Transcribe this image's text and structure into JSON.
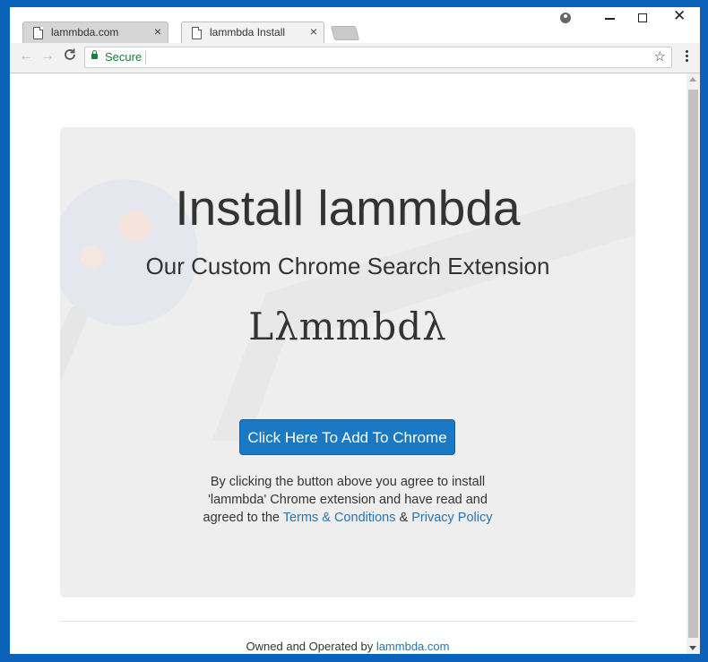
{
  "browser": {
    "tabs": [
      {
        "title": "lammbda.com",
        "active": false,
        "icon": "document-icon"
      },
      {
        "title": "lammbda Install",
        "active": true,
        "icon": "document-icon"
      }
    ],
    "tab_close_glyph": "×",
    "nav": {
      "back": "←",
      "forward": "→",
      "reload": "C"
    },
    "address": {
      "security_label": "Secure",
      "url": "",
      "security_color": "#188038"
    },
    "bookmark_glyph": "☆",
    "window_controls": {
      "close": "✕"
    }
  },
  "page": {
    "heading": "Install lammbda",
    "subheading": "Our Custom Chrome Search Extension",
    "logo_text": "Lλmmbdλ",
    "cta_label": "Click Here To Add To Chrome",
    "legal": {
      "line1": "By clicking the button above you agree to install",
      "line2": "'lammbda' Chrome extension and have read and",
      "line3_prefix": "agreed to the ",
      "terms_link": "Terms & Conditions",
      "amp": " & ",
      "privacy_link": "Privacy Policy"
    },
    "footer": {
      "prefix": "Owned and Operated by ",
      "link": "lammbda.com"
    }
  },
  "colors": {
    "accent": "#1b78c2",
    "link": "#2a74b0",
    "frame": "#0a63b8",
    "panel": "#eeeeee"
  }
}
